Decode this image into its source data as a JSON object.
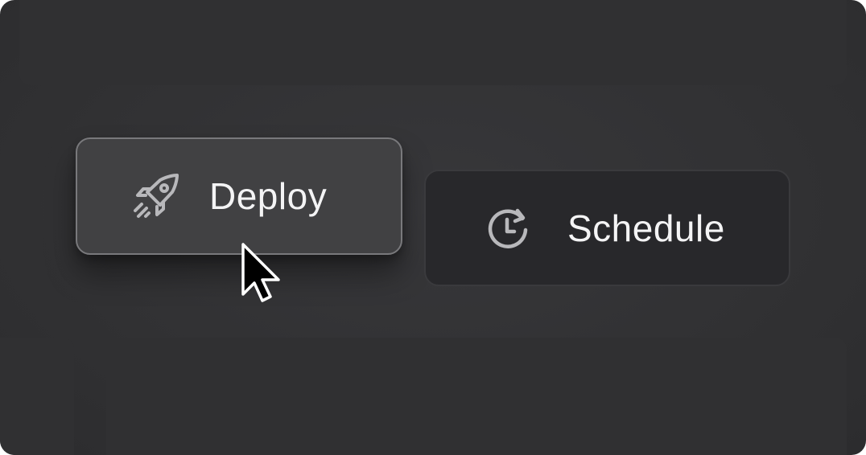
{
  "actions": {
    "deploy": {
      "label": "Deploy",
      "icon": "rocket-icon"
    },
    "schedule": {
      "label": "Schedule",
      "icon": "clock-refresh-icon"
    }
  },
  "pointer": {
    "icon": "mouse-cursor-icon"
  },
  "colors": {
    "background": "#333335",
    "deploy_fill": "#414143",
    "deploy_border": "#79797c",
    "schedule_fill": "#28282b",
    "text": "#f4f4f5",
    "icon": "#b8b8bb"
  }
}
